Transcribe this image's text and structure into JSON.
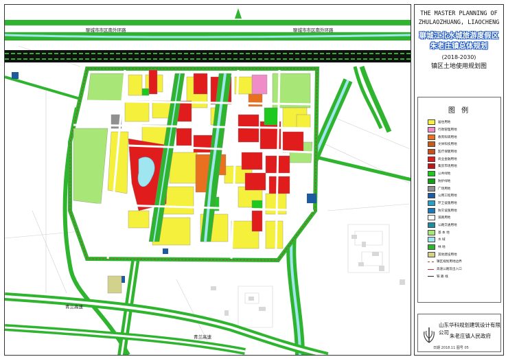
{
  "title": {
    "english": [
      "THE MASTER PLANNING OF",
      "ZHULAOZHUANG, LIAOCHENG"
    ],
    "chinese": [
      "聊城江北水城旅游度假区",
      "朱老庄镇总体规划"
    ],
    "period": "(2018-2030)",
    "subtitle": "镇区土地使用规划图"
  },
  "legend": {
    "title": "图 例",
    "items": [
      {
        "label": "居住用地",
        "color": "#f5f03c"
      },
      {
        "label": "行政管理用地",
        "color": "#f08cc8"
      },
      {
        "label": "教育科研用地",
        "color": "#e8701e"
      },
      {
        "label": "文体科技用地",
        "color": "#c85a14"
      },
      {
        "label": "医疗保健用地",
        "color": "#c8501e"
      },
      {
        "label": "商业金融用地",
        "color": "#e01c1c"
      },
      {
        "label": "集贸市场用地",
        "color": "#c01818"
      },
      {
        "label": "公共绿地",
        "color": "#1ec81e"
      },
      {
        "label": "防护绿地",
        "color": "#12a012"
      },
      {
        "label": "广场用地",
        "color": "#909090"
      },
      {
        "label": "公用工程用地",
        "color": "#1e5aa0"
      },
      {
        "label": "环卫设施用地",
        "color": "#28a0c8"
      },
      {
        "label": "防灾设施用地",
        "color": "#1e78b4"
      },
      {
        "label": "道路用地",
        "color": "#ffffff"
      },
      {
        "label": "公路交通用地",
        "color": "#1e8ca0"
      },
      {
        "label": "基 本 地",
        "color": "#a8e678"
      },
      {
        "label": "水 域",
        "color": "#a0e6f0"
      },
      {
        "label": "林 地",
        "color": "#2eb42e"
      },
      {
        "label": "其他建设用地",
        "color": "#d2d28c"
      },
      {
        "label": "镇区规划用地边界",
        "color": "#c03030",
        "style": "dash"
      },
      {
        "label": "高速公路及出入口",
        "color": "#c03030",
        "style": "line"
      },
      {
        "label": "铁 路 线",
        "color": "#222222",
        "style": "rail"
      }
    ]
  },
  "organization": {
    "designer": "山东华科规划建筑设计有限公司",
    "client": "朱老庄镇人民政府",
    "footer": "日期 2018.11 图号 05"
  },
  "map": {
    "road_labels": {
      "ring_road_west": "聊城市市区南外环路",
      "ring_road_east": "聊城市市区南外环路",
      "expressway_1": "青兰高速",
      "expressway_2": "青兰高速"
    },
    "colors": {
      "residential": "#f5f03c",
      "commercial": "#e01c1c",
      "green": "#1ec81e",
      "basic_land": "#a8e678",
      "water": "#a0e6f0",
      "education": "#e8701e",
      "admin": "#f08cc8",
      "utility": "#1e5aa0",
      "road_green": "#2eb42e"
    }
  }
}
